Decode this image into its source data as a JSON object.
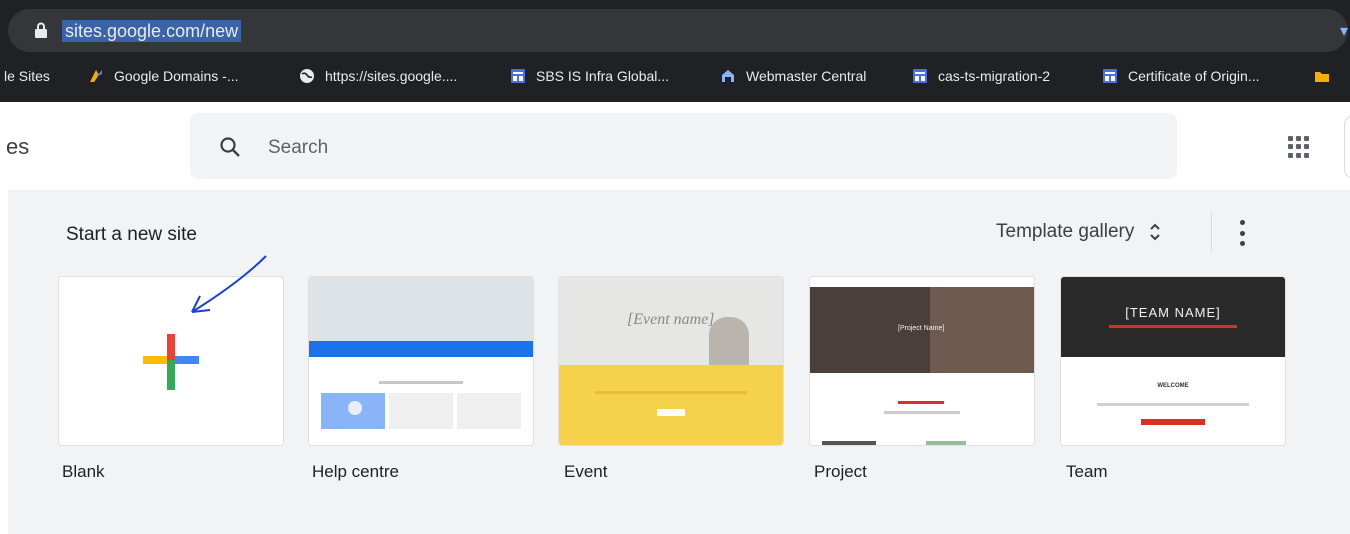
{
  "browser": {
    "url": "sites.google.com/new",
    "bookmarks": [
      {
        "label": "le Sites",
        "icon": "google-sites-icon"
      },
      {
        "label": "Google Domains -...",
        "icon": "google-domains-icon"
      },
      {
        "label": "https://sites.google....",
        "icon": "globe-icon"
      },
      {
        "label": "SBS IS Infra Global...",
        "icon": "sites-page-icon"
      },
      {
        "label": "Webmaster Central",
        "icon": "webmaster-icon"
      },
      {
        "label": "cas-ts-migration-2",
        "icon": "sites-page-icon"
      },
      {
        "label": "Certificate of Origin...",
        "icon": "sites-page-icon"
      }
    ]
  },
  "header": {
    "app_title": "es",
    "search_placeholder": "Search"
  },
  "panel": {
    "heading": "Start a new site",
    "template_gallery_label": "Template gallery"
  },
  "templates": [
    {
      "label": "Blank"
    },
    {
      "label": "Help centre"
    },
    {
      "label": "Event",
      "thumb_text": "[Event name]"
    },
    {
      "label": "Project",
      "thumb_text": "[Project Name]"
    },
    {
      "label": "Team",
      "thumb_text": "[TEAM NAME]",
      "thumb_subtext": "WELCOME"
    }
  ],
  "colors": {
    "google_blue": "#4285f4",
    "google_red": "#ea4335",
    "google_yellow": "#fbbc04",
    "google_green": "#34a853",
    "annotation_arrow": "#1a3fd6"
  }
}
